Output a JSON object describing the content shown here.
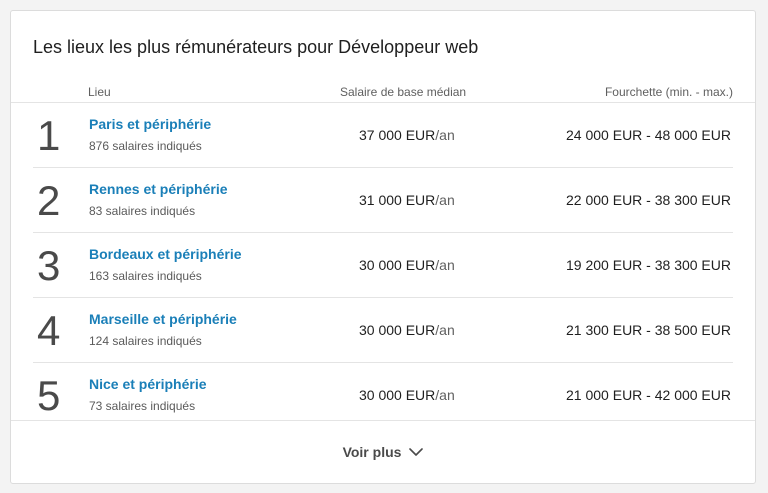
{
  "card": {
    "title": "Les lieux les plus rémunérateurs pour Développeur web"
  },
  "table": {
    "headers": {
      "location": "Lieu",
      "median": "Salaire de base médian",
      "range": "Fourchette (min. - max.)"
    },
    "rows": [
      {
        "rank": "1",
        "location": "Paris et périphérie",
        "count": "876 salaires indiqués",
        "salary": "37 000 EUR",
        "unit": "/an",
        "range": "24 000 EUR - 48 000 EUR"
      },
      {
        "rank": "2",
        "location": "Rennes et périphérie",
        "count": "83 salaires indiqués",
        "salary": "31 000 EUR",
        "unit": "/an",
        "range": "22 000 EUR - 38 300 EUR"
      },
      {
        "rank": "3",
        "location": "Bordeaux et périphérie",
        "count": "163 salaires indiqués",
        "salary": "30 000 EUR",
        "unit": "/an",
        "range": "19 200 EUR - 38 300 EUR"
      },
      {
        "rank": "4",
        "location": "Marseille et périphérie",
        "count": "124 salaires indiqués",
        "salary": "30 000 EUR",
        "unit": "/an",
        "range": "21 300 EUR - 38 500 EUR"
      },
      {
        "rank": "5",
        "location": "Nice et périphérie",
        "count": "73 salaires indiqués",
        "salary": "30 000 EUR",
        "unit": "/an",
        "range": "21 000 EUR - 42 000 EUR"
      }
    ]
  },
  "footer": {
    "more_label": "Voir plus",
    "more_icon": "chevron-down-icon"
  },
  "colors": {
    "link": "#1a7fb8",
    "text": "#1f1f1f",
    "muted": "#5f5f5f",
    "divider": "#e4e4e4"
  }
}
